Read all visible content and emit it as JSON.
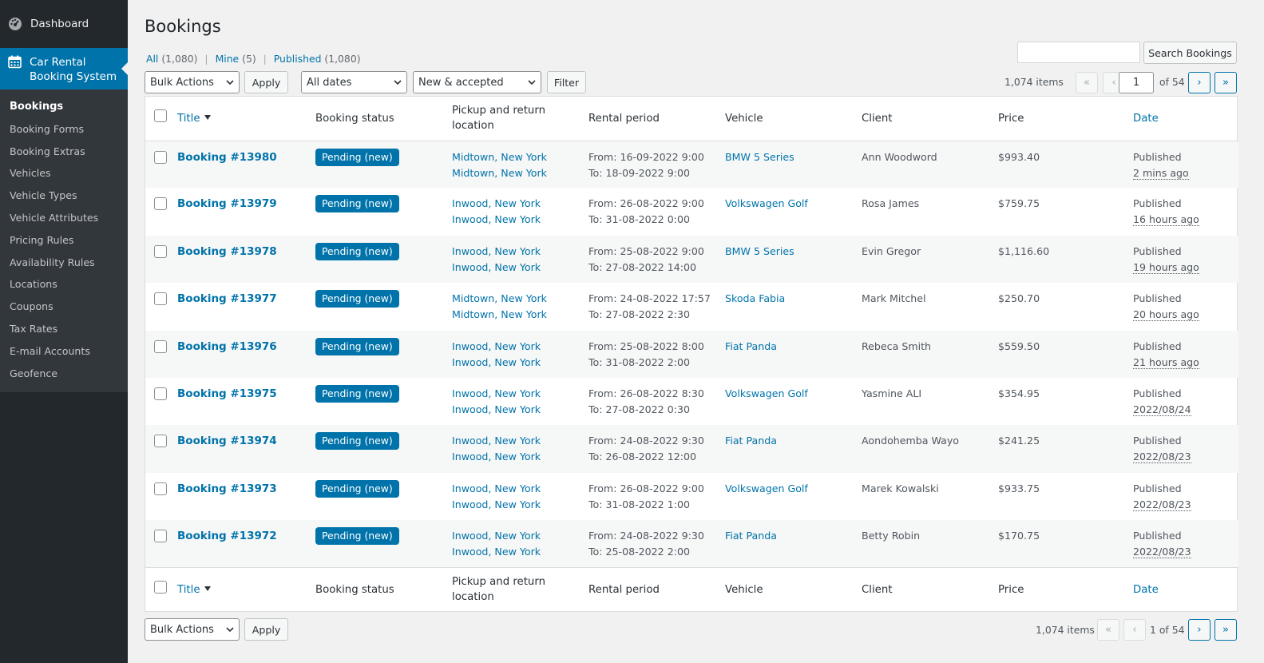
{
  "sidebar": {
    "dashboard": "Dashboard",
    "active_line1": "Car Rental",
    "active_line2": "Booking System",
    "items": [
      "Bookings",
      "Booking Forms",
      "Booking Extras",
      "Vehicles",
      "Vehicle Types",
      "Vehicle Attributes",
      "Pricing Rules",
      "Availability Rules",
      "Locations",
      "Coupons",
      "Tax Rates",
      "E-mail Accounts",
      "Geofence"
    ]
  },
  "page": {
    "title": "Bookings",
    "views": {
      "all_label": "All",
      "all_count": "(1,080)",
      "mine_label": "Mine",
      "mine_count": "(5)",
      "published_label": "Published",
      "published_count": "(1,080)",
      "sep": "|"
    },
    "search_button": "Search Bookings",
    "bulk_actions": "Bulk Actions",
    "apply": "Apply",
    "dates_filter": "All dates",
    "status_filter": "New & accepted",
    "filter": "Filter",
    "items_count": "1,074 items",
    "current_page": "1",
    "of_pages": "of 54",
    "bottom_pages": "1 of 54",
    "pg_first": "«",
    "pg_prev": "‹",
    "pg_next": "›",
    "pg_last": "»"
  },
  "table": {
    "columns": {
      "title": "Title",
      "status": "Booking status",
      "location_line1": "Pickup and return",
      "location_line2": "location",
      "period": "Rental period",
      "vehicle": "Vehicle",
      "client": "Client",
      "price": "Price",
      "date": "Date"
    },
    "rows": [
      {
        "title": "Booking #13980",
        "status": "Pending (new)",
        "pickup": "Midtown, New York",
        "return": "Midtown, New York",
        "from": "From: 16-09-2022 9:00",
        "to": "To: 18-09-2022 9:00",
        "vehicle": "BMW 5 Series",
        "client": "Ann Woodword",
        "price": "$993.40",
        "date_status": "Published",
        "date": "2 mins ago"
      },
      {
        "title": "Booking #13979",
        "status": "Pending (new)",
        "pickup": "Inwood, New York",
        "return": "Inwood, New York",
        "from": "From: 26-08-2022 9:00",
        "to": "To: 31-08-2022 0:00",
        "vehicle": "Volkswagen Golf",
        "client": "Rosa James",
        "price": "$759.75",
        "date_status": "Published",
        "date": "16 hours ago"
      },
      {
        "title": "Booking #13978",
        "status": "Pending (new)",
        "pickup": "Inwood, New York",
        "return": "Inwood, New York",
        "from": "From: 25-08-2022 9:00",
        "to": "To: 27-08-2022 14:00",
        "vehicle": "BMW 5 Series",
        "client": "Evin Gregor",
        "price": "$1,116.60",
        "date_status": "Published",
        "date": "19 hours ago"
      },
      {
        "title": "Booking #13977",
        "status": "Pending (new)",
        "pickup": "Midtown, New York",
        "return": "Midtown, New York",
        "from": "From: 24-08-2022 17:57",
        "to": "To: 27-08-2022 2:30",
        "vehicle": "Skoda Fabia",
        "client": "Mark Mitchel",
        "price": "$250.70",
        "date_status": "Published",
        "date": "20 hours ago"
      },
      {
        "title": "Booking #13976",
        "status": "Pending (new)",
        "pickup": "Inwood, New York",
        "return": "Inwood, New York",
        "from": "From: 25-08-2022 8:00",
        "to": "To: 31-08-2022 2:00",
        "vehicle": "Fiat Panda",
        "client": "Rebeca Smith",
        "price": "$559.50",
        "date_status": "Published",
        "date": "21 hours ago"
      },
      {
        "title": "Booking #13975",
        "status": "Pending (new)",
        "pickup": "Inwood, New York",
        "return": "Inwood, New York",
        "from": "From: 26-08-2022 8:30",
        "to": "To: 27-08-2022 0:30",
        "vehicle": "Volkswagen Golf",
        "client": "Yasmine ALI",
        "price": "$354.95",
        "date_status": "Published",
        "date": "2022/08/24"
      },
      {
        "title": "Booking #13974",
        "status": "Pending (new)",
        "pickup": "Inwood, New York",
        "return": "Inwood, New York",
        "from": "From: 24-08-2022 9:30",
        "to": "To: 26-08-2022 12:00",
        "vehicle": "Fiat Panda",
        "client": "Aondohemba Wayo",
        "price": "$241.25",
        "date_status": "Published",
        "date": "2022/08/23"
      },
      {
        "title": "Booking #13973",
        "status": "Pending (new)",
        "pickup": "Inwood, New York",
        "return": "Inwood, New York",
        "from": "From: 26-08-2022 9:00",
        "to": "To: 31-08-2022 1:00",
        "vehicle": "Volkswagen Golf",
        "client": "Marek Kowalski",
        "price": "$933.75",
        "date_status": "Published",
        "date": "2022/08/23"
      },
      {
        "title": "Booking #13972",
        "status": "Pending (new)",
        "pickup": "Inwood, New York",
        "return": "Inwood, New York",
        "from": "From: 24-08-2022 9:30",
        "to": "To: 25-08-2022 2:00",
        "vehicle": "Fiat Panda",
        "client": "Betty Robin",
        "price": "$170.75",
        "date_status": "Published",
        "date": "2022/08/23"
      }
    ]
  },
  "icons": {
    "dashboard": "dashboard-gauge-icon",
    "calendar": "calendar-icon",
    "chevron": "chevron-down-icon",
    "sort": "sort-desc-icon"
  },
  "colors": {
    "sidebar_bg": "#23282d",
    "sidebar_submenu_bg": "#32373c",
    "accent": "#0073aa",
    "page_bg": "#f1f1f1"
  }
}
